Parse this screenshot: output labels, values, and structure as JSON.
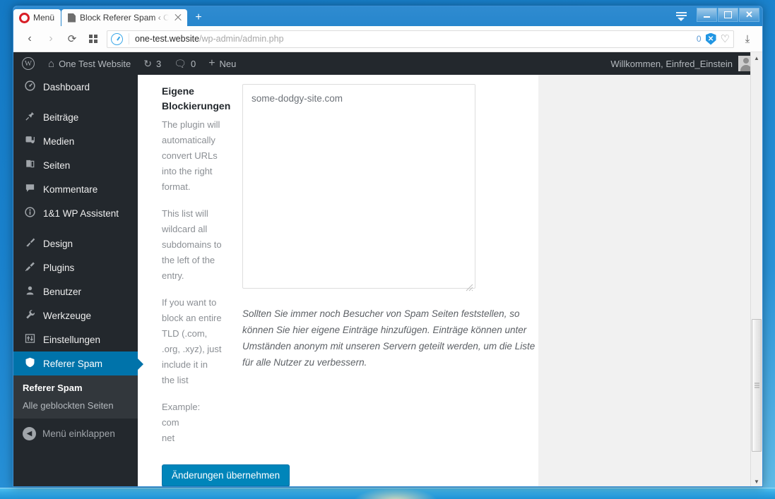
{
  "browser": {
    "menu_label": "Menü",
    "tab": {
      "title": "Block Referer Spam ‹ One",
      "favicon": "document-icon",
      "close": "×"
    },
    "newtab_label": "+",
    "window_controls": {
      "minimize": "minimize-icon",
      "maximize": "maximize-icon",
      "close": "✕"
    },
    "easy_setup": "easy-setup-icon",
    "nav": {
      "back": "‹",
      "forward": "›",
      "reload": "⟳",
      "speeddial": "speed-dial-icon"
    },
    "address": {
      "host": "one-test.website",
      "path": "/wp-admin/admin.php",
      "badge_icon": "page-info-icon",
      "blocked_count": "0",
      "shield_label": "✕",
      "heart_icon": "♡",
      "download_icon": "⤓"
    }
  },
  "adminbar": {
    "wp_logo": "W",
    "site_name": "One Test Website",
    "home_icon": "⌂",
    "updates_icon": "↻",
    "updates_count": "3",
    "comments_icon": "💬",
    "comments_count": "0",
    "new_icon": "+",
    "new_label": "Neu",
    "greeting": "Willkommen, Einfred_Einstein",
    "avatar": "avatar"
  },
  "sidebar": {
    "items": [
      {
        "label": "Dashboard",
        "icon": "dashboard-icon",
        "glyph": "◕",
        "sep_after": true
      },
      {
        "label": "Beiträge",
        "icon": "posts-pin-icon",
        "glyph": "📌",
        "sep_after": false
      },
      {
        "label": "Medien",
        "icon": "media-icon",
        "glyph": "♫",
        "sep_after": false
      },
      {
        "label": "Seiten",
        "icon": "pages-icon",
        "glyph": "❐",
        "sep_after": false
      },
      {
        "label": "Kommentare",
        "icon": "comments-icon",
        "glyph": "💬",
        "sep_after": false
      },
      {
        "label": "1&1 WP Assistent",
        "icon": "assistant-info-icon",
        "glyph": "ⓘ",
        "sep_after": true
      },
      {
        "label": "Design",
        "icon": "appearance-brush-icon",
        "glyph": "🖌",
        "sep_after": false
      },
      {
        "label": "Plugins",
        "icon": "plugins-plug-icon",
        "glyph": "⚿",
        "sep_after": false
      },
      {
        "label": "Benutzer",
        "icon": "users-icon",
        "glyph": "👤",
        "sep_after": false
      },
      {
        "label": "Werkzeuge",
        "icon": "tools-wrench-icon",
        "glyph": "🔧",
        "sep_after": false
      },
      {
        "label": "Einstellungen",
        "icon": "settings-sliders-icon",
        "glyph": "⚙",
        "sep_after": false
      }
    ],
    "current": {
      "label": "Referer Spam",
      "icon": "shield-icon",
      "glyph": "🛡"
    },
    "submenu": [
      {
        "label": "Referer Spam",
        "active": true
      },
      {
        "label": "Alle geblockten Seiten",
        "active": false
      }
    ],
    "collapse": {
      "label": "Menü einklappen",
      "icon": "collapse-arrow-icon",
      "glyph": "◀"
    }
  },
  "main": {
    "field_title_line1": "Eigene",
    "field_title_line2": "Blockierungen",
    "help_paragraph_1": "The plugin will automatically convert URLs into the right format.",
    "help_paragraph_2": "This list will wildcard all subdomains to the left of the entry.",
    "help_paragraph_3": "If you want to block an entire TLD (.com, .org, .xyz), just include it in the list",
    "help_example_label": "Example:",
    "help_example_1": "com",
    "help_example_2": "net",
    "textarea_value": "some-dodgy-site.com",
    "textarea_placeholder": "",
    "note": "Sollten Sie immer noch Besucher von Spam Seiten feststellen, so können Sie hier eigene Einträge hinzufügen. Einträge können unter Umständen anonym mit unseren Servern geteilt werden, um die Liste für alle Nutzer zu verbessern.",
    "submit_label": "Änderungen übernehmen"
  },
  "scrollbar": {
    "up": "▲",
    "down": "▼"
  },
  "colors": {
    "wp_admin_bg": "#23282d",
    "wp_submenu_bg": "#32373c",
    "wp_accent": "#0073aa",
    "wp_button": "#0085ba",
    "content_bg": "#ffffff",
    "page_bg": "#f1f1f1"
  }
}
